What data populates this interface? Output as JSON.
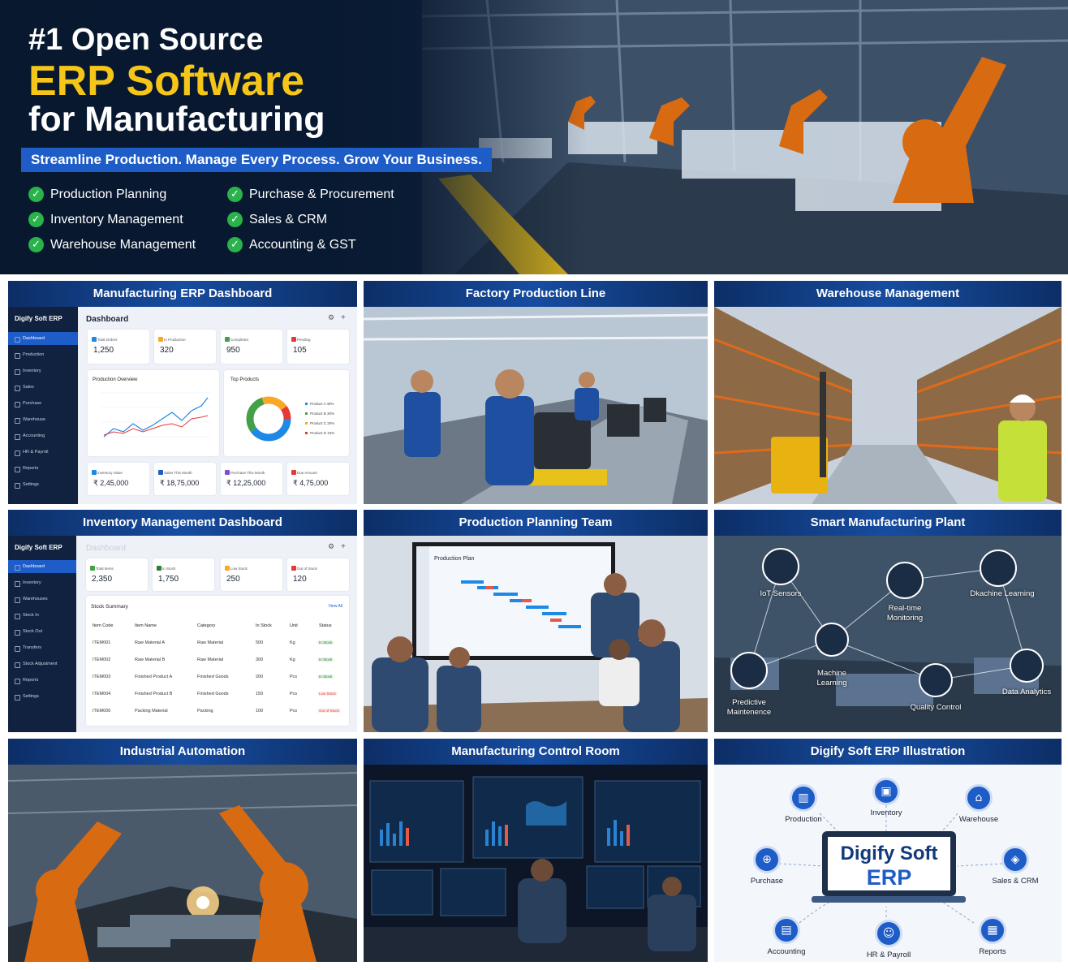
{
  "hero": {
    "line1": "#1 Open Source",
    "line2": "ERP Software",
    "line3": "for Manufacturing",
    "tagline": "Streamline Production. Manage Every Process. Grow Your Business.",
    "features_left": [
      "Production Planning",
      "Inventory Management",
      "Warehouse Management"
    ],
    "features_right": [
      "Purchase & Procurement",
      "Sales & CRM",
      "Accounting & GST"
    ]
  },
  "tiles": {
    "t1": "Manufacturing ERP Dashboard",
    "t2": "Factory Production Line",
    "t3": "Warehouse Management",
    "t4": "Inventory Management Dashboard",
    "t5": "Production Planning Team",
    "t6": "Smart Manufacturing Plant",
    "t7": "Industrial Automation",
    "t8": "Manufacturing Control Room",
    "t9": "Digify Soft ERP Illustration"
  },
  "dash1": {
    "brand": "Digify Soft ERP",
    "title": "Dashboard",
    "nav": [
      "Dashboard",
      "Production",
      "Inventory",
      "Sales",
      "Purchase",
      "Warehouse",
      "Accounting",
      "HR & Payroll",
      "Reports",
      "Settings"
    ],
    "cards": [
      {
        "label": "Total Orders",
        "value": "1,250",
        "color": "#1e88e5"
      },
      {
        "label": "In Production",
        "value": "320",
        "color": "#f9a825"
      },
      {
        "label": "Completed",
        "value": "950",
        "color": "#43a047"
      },
      {
        "label": "Pending",
        "value": "105",
        "color": "#e53935"
      }
    ],
    "panel1": "Production Overview",
    "panel2": "Top Products",
    "legend": [
      "Product A 40%",
      "Product B 30%",
      "Product C 20%",
      "Product D 10%"
    ],
    "bottom": [
      {
        "label": "Inventory Value",
        "value": "₹ 2,45,000",
        "color": "#1e88e5"
      },
      {
        "label": "Sales This Month",
        "value": "₹ 18,75,000",
        "color": "#1e5cc8"
      },
      {
        "label": "Purchase This Month",
        "value": "₹ 12,25,000",
        "color": "#7b4fd0"
      },
      {
        "label": "Due Amount",
        "value": "₹ 4,75,000",
        "color": "#e53935"
      }
    ]
  },
  "dash2": {
    "brand": "Digify Soft ERP",
    "title": "Dashboard",
    "nav": [
      "Dashboard",
      "Inventory",
      "Warehouses",
      "Stock In",
      "Stock Out",
      "Transfers",
      "Stock Adjustment",
      "Reports",
      "Settings"
    ],
    "cards": [
      {
        "label": "Total Items",
        "value": "2,350",
        "color": "#43a047"
      },
      {
        "label": "In Stock",
        "value": "1,750",
        "color": "#2e7d32"
      },
      {
        "label": "Low Stock",
        "value": "250",
        "color": "#f9a825"
      },
      {
        "label": "Out of Stock",
        "value": "120",
        "color": "#e53935"
      }
    ],
    "summary_title": "Stock Summary",
    "view_all": "View All",
    "headers": [
      "Item Code",
      "Item Name",
      "Category",
      "In Stock",
      "Unit",
      "Status"
    ],
    "rows": [
      [
        "ITEM001",
        "Raw Material A",
        "Raw Material",
        "500",
        "Kg",
        "In Stock"
      ],
      [
        "ITEM002",
        "Raw Material B",
        "Raw Material",
        "300",
        "Kg",
        "In Stock"
      ],
      [
        "ITEM003",
        "Finished Product A",
        "Finished Goods",
        "200",
        "Pcs",
        "In Stock"
      ],
      [
        "ITEM004",
        "Finished Product B",
        "Finished Goods",
        "150",
        "Pcs",
        "Low Stock"
      ],
      [
        "ITEM005",
        "Packing Material",
        "Packing",
        "100",
        "Pcs",
        "Out of Stock"
      ]
    ]
  },
  "planning": {
    "screen_title": "Production Plan"
  },
  "smart": {
    "iot": "IoT Sensors",
    "ml_top": "Dkachine Learning",
    "realtime": "Real-time Monitoring",
    "ml_mid": "Machine Learning",
    "predictive": "Predictive Maintenence",
    "quality": "Quality Control",
    "analytics": "Data Analytics"
  },
  "illustration": {
    "center_line1": "Digify Soft",
    "center_line2": "ERP",
    "modules": [
      "Production",
      "Inventory",
      "Warehouse",
      "Purchase",
      "Sales & CRM",
      "Accounting",
      "HR & Payroll",
      "Reports"
    ]
  }
}
